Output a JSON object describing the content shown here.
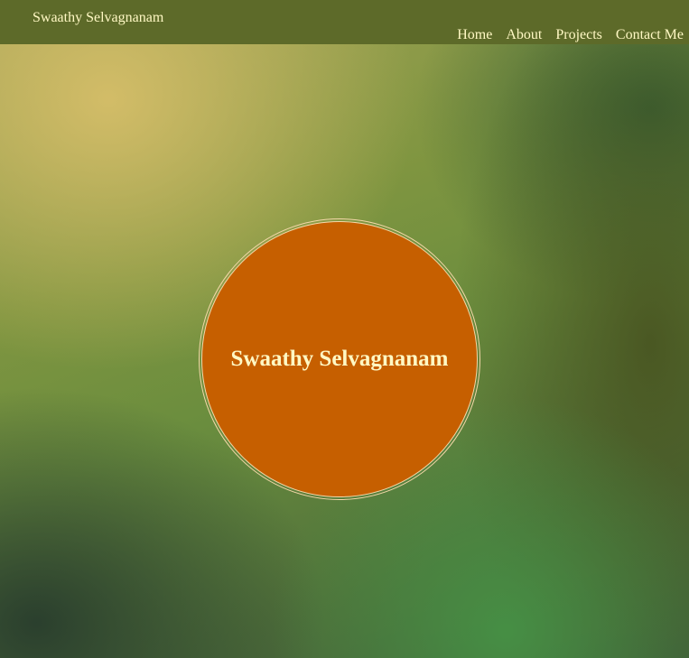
{
  "header": {
    "brand": "Swaathy Selvagnanam",
    "nav": [
      {
        "label": "Home"
      },
      {
        "label": "About"
      },
      {
        "label": "Projects"
      },
      {
        "label": "Contact Me"
      }
    ]
  },
  "hero": {
    "name": "Swaathy Selvagnanam"
  },
  "colors": {
    "header_bg": "#5d6a29",
    "text": "#fff8c4",
    "circle_fill": "#c65f00",
    "circle_border": "#f3d7a8"
  }
}
